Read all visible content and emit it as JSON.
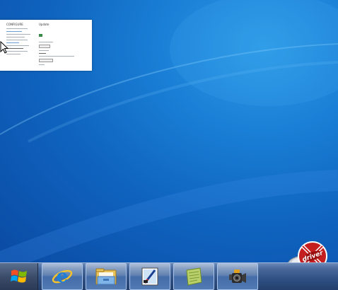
{
  "desktop": {
    "wallpaper_color": "#1570cf",
    "thumbnail": {
      "title": "CONFIGURE",
      "subtitle": "Update"
    }
  },
  "watermark": {
    "text": "driver"
  },
  "taskbar": {
    "start_icon": "windows-logo-icon",
    "pinned_items": [
      {
        "icon": "internet-explorer-icon"
      },
      {
        "icon": "file-explorer-icon"
      },
      {
        "icon": "paint-icon"
      },
      {
        "icon": "notepad-icon"
      },
      {
        "icon": "video-camera-icon"
      }
    ]
  }
}
